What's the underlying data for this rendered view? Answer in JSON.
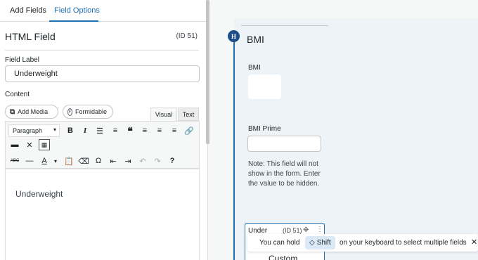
{
  "tabs": {
    "add_fields": "Add Fields",
    "field_options": "Field Options"
  },
  "field": {
    "title": "HTML Field",
    "id": "(ID 51)",
    "label_heading": "Field Label",
    "label_value": "Underweight",
    "content_heading": "Content"
  },
  "editor": {
    "add_media": "Add Media",
    "formidable": "Formidable",
    "tab_visual": "Visual",
    "tab_text": "Text",
    "format_select": "Paragraph",
    "body_text": "Underweight"
  },
  "toolbar_icons": [
    "bold-icon",
    "italic-icon",
    "bulleted-list-icon",
    "numbered-list-icon",
    "blockquote-icon",
    "align-left-icon",
    "align-center-icon",
    "align-right-icon",
    "link-icon",
    "insert-more-icon",
    "fullscreen-icon",
    "toolbar-toggle-icon",
    "strikethrough-icon",
    "horizontal-line-icon",
    "text-color-icon",
    "paste-as-text-icon",
    "clear-formatting-icon",
    "special-character-icon",
    "outdent-icon",
    "indent-icon",
    "undo-icon",
    "redo-icon",
    "help-icon"
  ],
  "canvas": {
    "section_badge": "H",
    "section_title": "BMI",
    "bmi_label": "BMI",
    "bmi_prime_label": "BMI Prime",
    "note": "Note: This field will not show in the form. Enter the value to be hidden.",
    "card_name": "Under",
    "card_id": "(ID 51)",
    "card_custom": "Custom"
  },
  "toast": {
    "prefix": "You can hold",
    "key": "Shift",
    "suffix": "on your keyboard to select multiple fields"
  },
  "colors": {
    "accent": "#2271b1",
    "badge": "#1d4e89",
    "canvas_bg": "#eef3f8"
  }
}
